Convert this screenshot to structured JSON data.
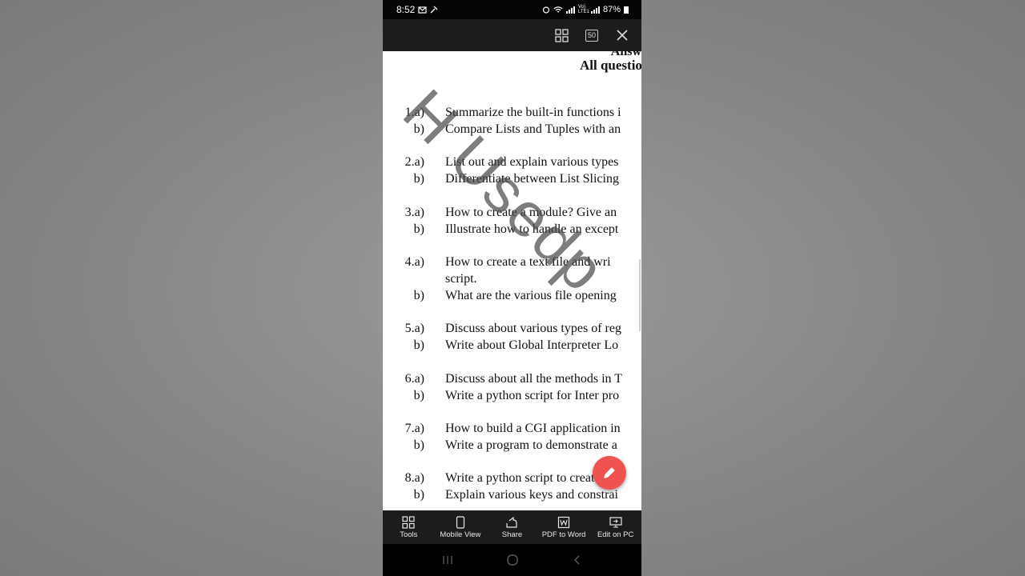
{
  "status": {
    "time": "8:52",
    "network": "Vo) LTE1",
    "battery": "87%"
  },
  "toolbar": {
    "page_count": "50"
  },
  "doc": {
    "header_cut": "Answ",
    "header": "All questio",
    "watermark": "H Usedp",
    "questions": [
      {
        "num": "1.a)",
        "text": "Summarize the built-in functions i"
      },
      {
        "num": "b)",
        "text": "Compare Lists and Tuples with an"
      },
      {
        "num": "2.a)",
        "text": "List out and explain various types"
      },
      {
        "num": "b)",
        "text": "Differentiate between List Slicing"
      },
      {
        "num": "3.a)",
        "text": "How to create a module? Give an"
      },
      {
        "num": "b)",
        "text": "Illustrate how to handle an except"
      },
      {
        "num": "4.a)",
        "text": "How to create a text file and wri"
      },
      {
        "num": "",
        "text": "script."
      },
      {
        "num": "b)",
        "text": "What are the various file opening"
      },
      {
        "num": "5.a)",
        "text": "Discuss about various types of reg"
      },
      {
        "num": "b)",
        "text": "Write about Global Interpreter Lo"
      },
      {
        "num": "6.a)",
        "text": "Discuss about all the methods in T"
      },
      {
        "num": "b)",
        "text": "Write a python script for Inter pro"
      },
      {
        "num": "7.a)",
        "text": "How to build a CGI application in"
      },
      {
        "num": "b)",
        "text": "Write a program to demonstrate a"
      },
      {
        "num": "8.a)",
        "text": "Write a python script to create a ta"
      },
      {
        "num": "b)",
        "text": "Explain various keys and constrai"
      }
    ]
  },
  "bottom_bar": {
    "tools": "Tools",
    "mobile_view": "Mobile View",
    "share": "Share",
    "pdf_to_word": "PDF to Word",
    "edit_on_pc": "Edit on PC"
  },
  "colors": {
    "fab": "#ef5350",
    "toolbar_bg": "#1c1c1c"
  }
}
